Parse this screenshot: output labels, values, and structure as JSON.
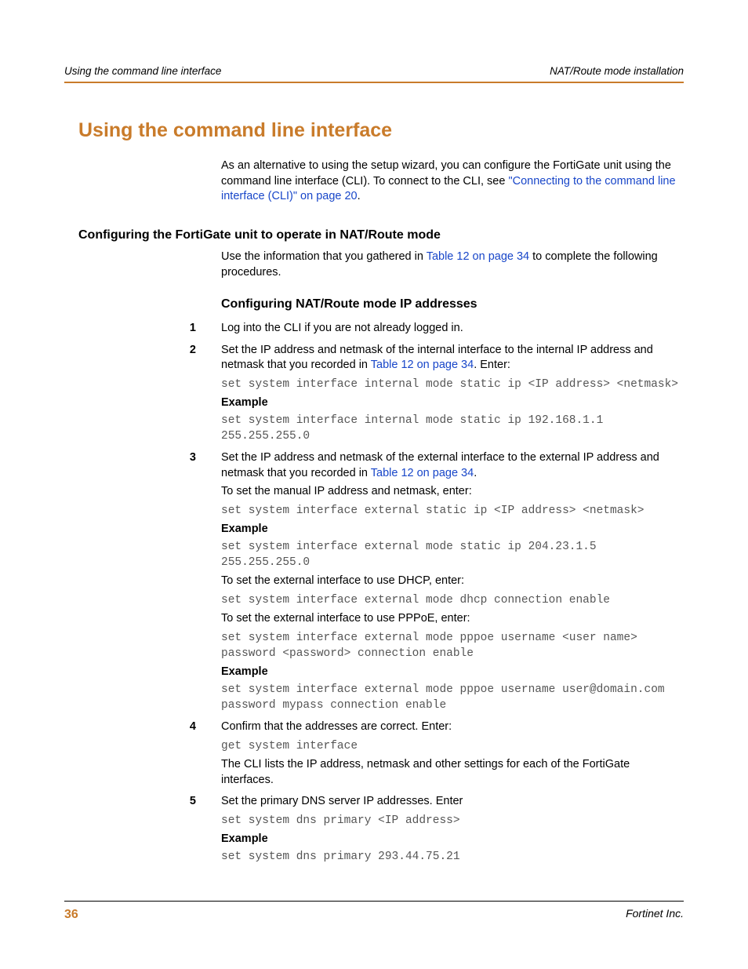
{
  "header": {
    "left": "Using the command line interface",
    "right": "NAT/Route mode installation"
  },
  "title": "Using the command line interface",
  "intro": {
    "text_before_link": "As an alternative to using the setup wizard, you can configure the FortiGate unit using the command line interface (CLI). To connect to the CLI, see ",
    "link": "\"Connecting to the command line interface (CLI)\" on page 20",
    "text_after_link": "."
  },
  "subsection1": "Configuring the FortiGate unit to operate in NAT/Route mode",
  "sub1_para": {
    "before": "Use the information that you gathered in ",
    "link": "Table 12 on page 34",
    "after": " to complete the following procedures."
  },
  "subsection2": "Configuring NAT/Route mode IP addresses",
  "steps": {
    "s1": {
      "num": "1",
      "text": "Log into the CLI if you are not already logged in."
    },
    "s2": {
      "num": "2",
      "intro_before": "Set the IP address and netmask of the internal interface to the internal IP address and netmask that you recorded in ",
      "intro_link": "Table 12 on page 34",
      "intro_after": ". Enter:",
      "code1": "set system interface internal mode static ip <IP address> <netmask>",
      "example_label": "Example",
      "code2": "set system interface internal mode static ip 192.168.1.1 255.255.255.0"
    },
    "s3": {
      "num": "3",
      "intro_before": "Set the IP address and netmask of the external interface to the external IP address and netmask that you recorded in ",
      "intro_link": "Table 12 on page 34",
      "intro_after": ".",
      "p1": "To set the manual IP address and netmask, enter:",
      "code1": "set system interface external static ip <IP address> <netmask>",
      "example_label1": "Example",
      "code2": "set system interface external mode static ip 204.23.1.5 255.255.255.0",
      "p2": "To set the external interface to use DHCP, enter:",
      "code3": "set system interface external mode dhcp connection enable",
      "p3": "To set the external interface to use PPPoE, enter:",
      "code4": "set system interface external mode pppoe username <user name> password <password> connection enable",
      "example_label2": "Example",
      "code5": "set system interface external mode pppoe username user@domain.com password mypass connection enable"
    },
    "s4": {
      "num": "4",
      "intro": "Confirm that the addresses are correct. Enter:",
      "code1": "get system interface",
      "p1": "The CLI lists the IP address, netmask and other settings for each of the FortiGate interfaces."
    },
    "s5": {
      "num": "5",
      "intro": "Set the primary DNS server IP addresses. Enter",
      "code1": "set system dns primary <IP address>",
      "example_label": "Example",
      "code2": "set system dns primary 293.44.75.21"
    }
  },
  "footer": {
    "page": "36",
    "company": "Fortinet Inc."
  }
}
